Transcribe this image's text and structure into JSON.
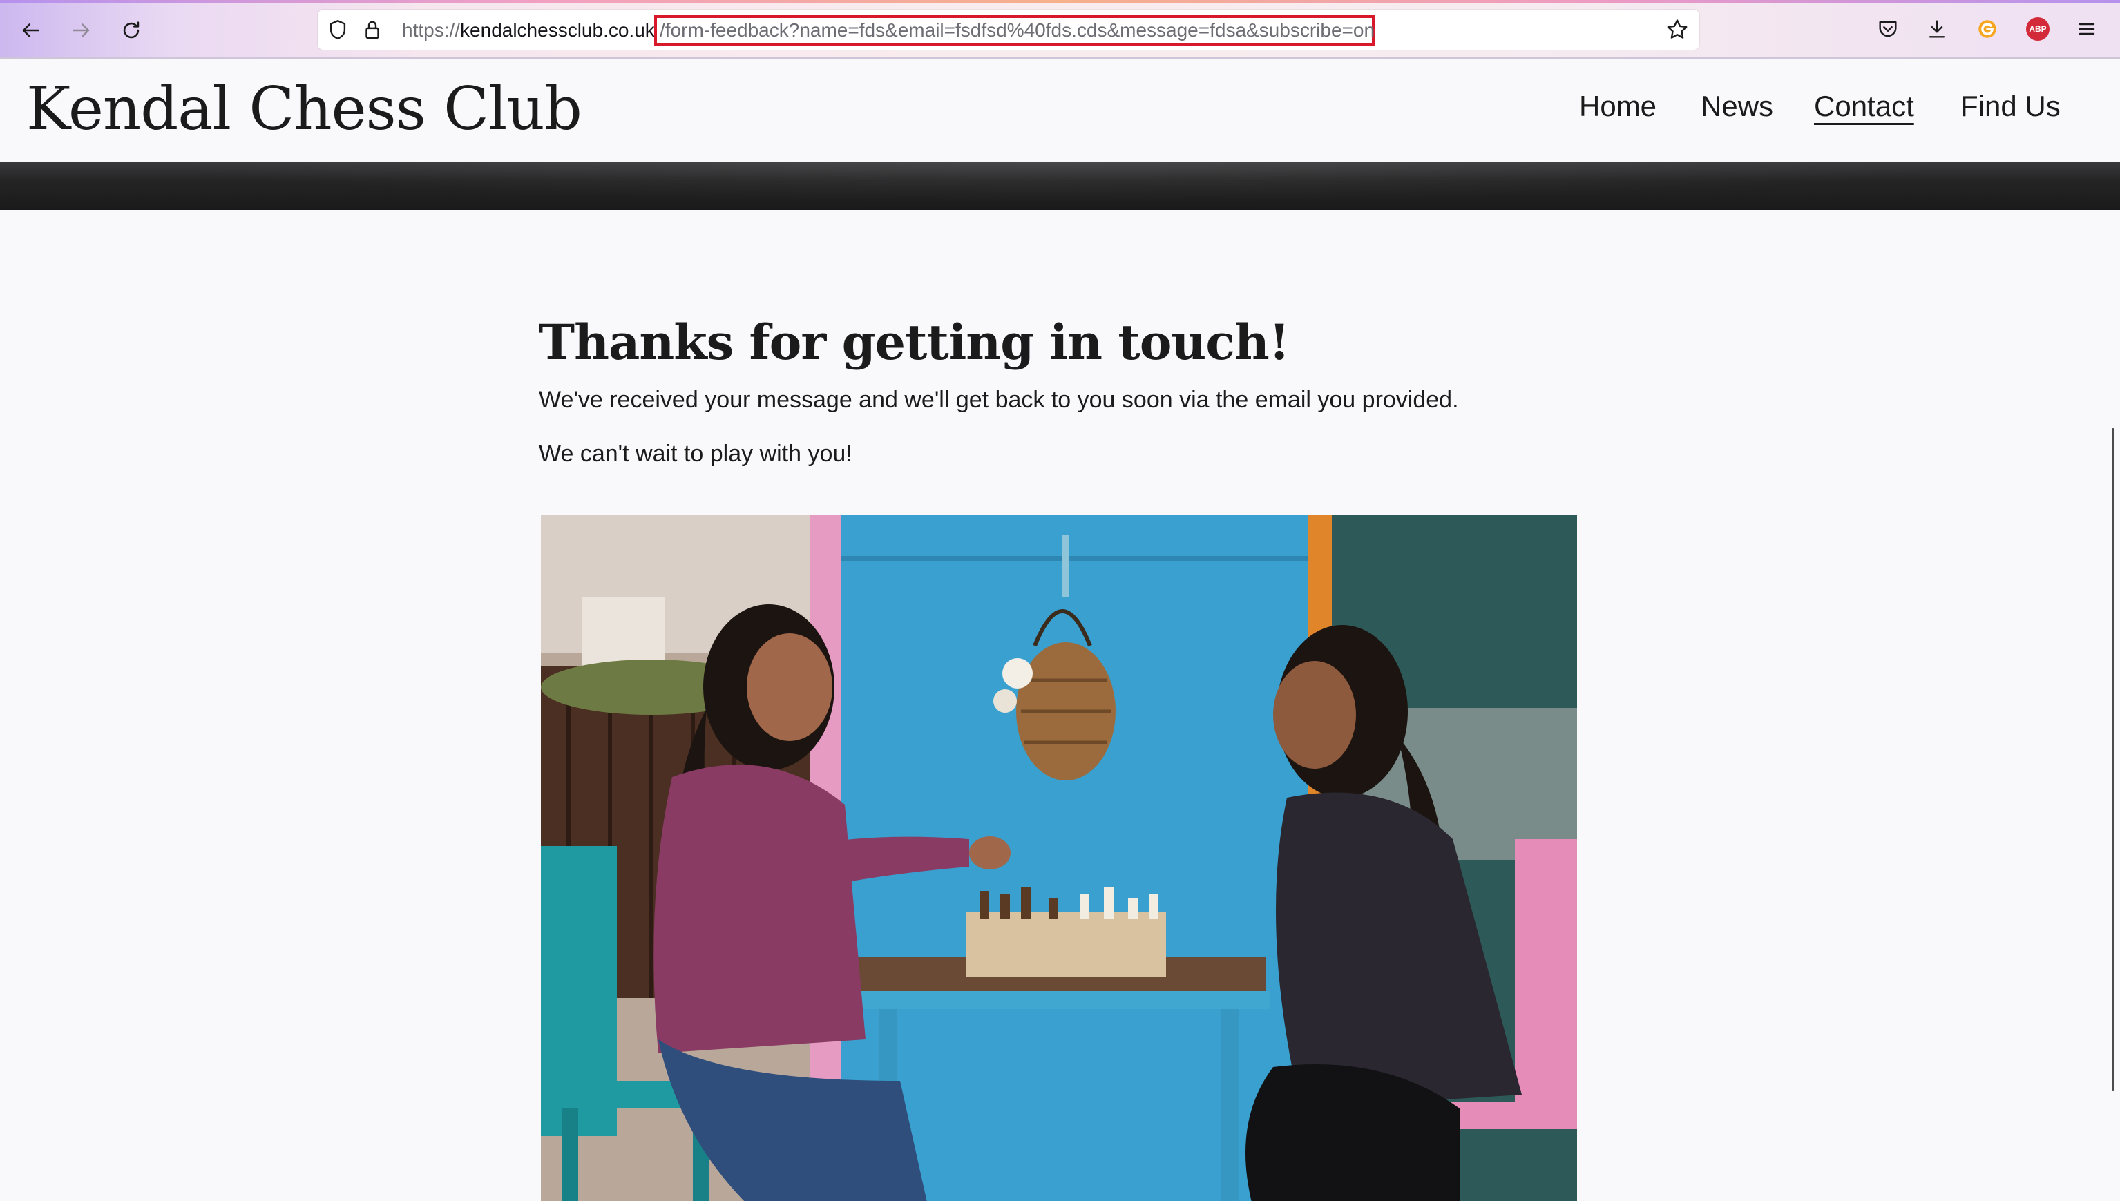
{
  "browser": {
    "url_scheme": "https://",
    "url_host": "kendalchessclub.co.uk",
    "url_path": "/form-feedback?name=fds&email=fsdfsd%40fds.cds&message=fdsa&subscribe=on",
    "highlight_color": "#d7192b",
    "icons": [
      "back-icon",
      "forward-icon",
      "reload-icon",
      "shield-icon",
      "lock-icon",
      "bookmark-star-icon",
      "pocket-icon",
      "download-icon",
      "extension-icon",
      "adblock-icon",
      "menu-icon"
    ],
    "adblock_label": "ABP"
  },
  "site": {
    "title": "Kendal Chess Club",
    "nav": [
      {
        "label": "Home",
        "active": false
      },
      {
        "label": "News",
        "active": false
      },
      {
        "label": "Contact",
        "active": true
      },
      {
        "label": "Find Us",
        "active": false
      }
    ]
  },
  "content": {
    "heading": "Thanks for getting in touch!",
    "paragraph1": "We've received your message and we'll get back to you soon via the email you provided.",
    "paragraph2": "We can't wait to play with you!"
  },
  "colors": {
    "accent_wall": "#3aa0cf",
    "text": "#1b1b1b"
  }
}
